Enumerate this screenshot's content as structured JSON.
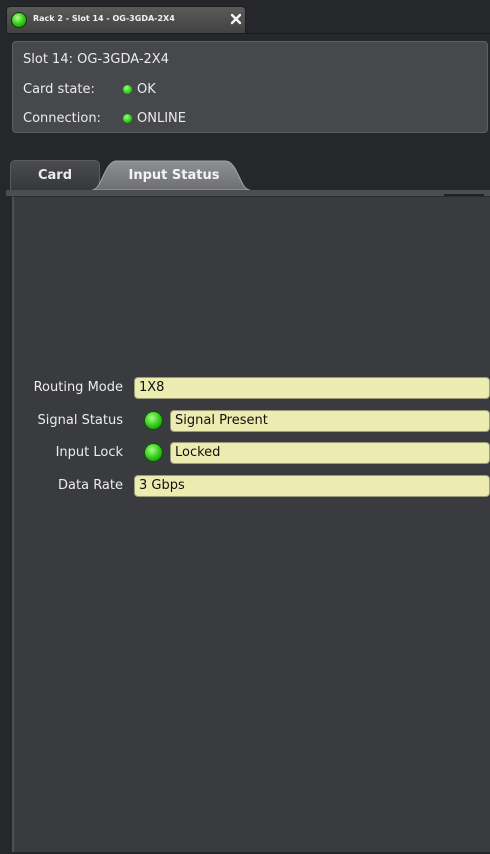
{
  "window": {
    "title": "Rack 2 - Slot 14 - OG-3GDA-2X4"
  },
  "info": {
    "slot": "Slot 14: OG-3GDA-2X4",
    "card_state_label": "Card state:",
    "card_state_value": "OK",
    "connection_label": "Connection:",
    "connection_value": "ONLINE"
  },
  "tabs": [
    {
      "label": "Card",
      "active": false
    },
    {
      "label": "Input Status",
      "active": true
    }
  ],
  "fields": {
    "routing_mode": {
      "label": "Routing Mode",
      "value": "1X8"
    },
    "signal_status": {
      "label": "Signal Status",
      "value": "Signal Present",
      "led": "green"
    },
    "input_lock": {
      "label": "Input Lock",
      "value": "Locked",
      "led": "green"
    },
    "data_rate": {
      "label": "Data Rate",
      "value": "3 Gbps"
    }
  },
  "colors": {
    "led_ok": "#2fd316",
    "field_bg": "#ecebb0",
    "panel_bg": "#3a3b3e"
  }
}
